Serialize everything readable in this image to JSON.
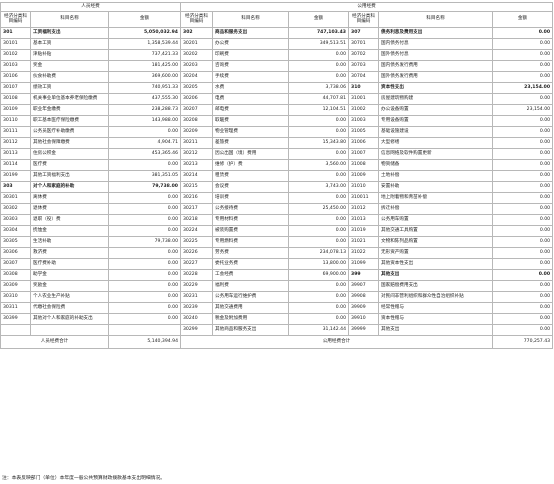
{
  "headers": {
    "personnel_group": "人员经费",
    "public_group": "公用经费",
    "code_col": "经济分类科目编码",
    "name_col": "科目名称",
    "amount_col": "金额"
  },
  "rows": [
    {
      "c1": "301",
      "n1": "工资福利支出",
      "a1": "5,050,032.94",
      "c2": "302",
      "n2": "商品和服务支出",
      "a2": "747,103.43",
      "c3": "307",
      "n3": "债务利息及费用支出",
      "a3": "0.00",
      "sub1": true,
      "sub2": true,
      "sub3": true
    },
    {
      "c1": "30101",
      "n1": "基本工资",
      "a1": "1,358,539.44",
      "c2": "30201",
      "n2": "办公费",
      "a2": "349,513.51",
      "c3": "30701",
      "n3": "国内债务付息",
      "a3": "0.00"
    },
    {
      "c1": "30102",
      "n1": "津贴补贴",
      "a1": "737,421.33",
      "c2": "30202",
      "n2": "印刷费",
      "a2": "0.00",
      "c3": "30702",
      "n3": "国外债务付息",
      "a3": "0.00"
    },
    {
      "c1": "30103",
      "n1": "奖金",
      "a1": "181,425.00",
      "c2": "30203",
      "n2": "咨询费",
      "a2": "0.00",
      "c3": "30703",
      "n3": "国内债务发行费用",
      "a3": "0.00"
    },
    {
      "c1": "30106",
      "n1": "伙食补助费",
      "a1": "369,600.00",
      "c2": "30204",
      "n2": "手续费",
      "a2": "0.00",
      "c3": "30704",
      "n3": "国外债务发行费用",
      "a3": "0.00"
    },
    {
      "c1": "30107",
      "n1": "绩效工资",
      "a1": "740,951.33",
      "c2": "30205",
      "n2": "水费",
      "a2": "3,738.06",
      "c3": "310",
      "n3": "资本性支出",
      "a3": "23,154.00",
      "sub3": true
    },
    {
      "c1": "30108",
      "n1": "机关事业单位基本养老保险缴费",
      "a1": "437,555.30",
      "c2": "30206",
      "n2": "电费",
      "a2": "44,707.81",
      "c3": "31001",
      "n3": "房屋建筑物购建",
      "a3": "0.00"
    },
    {
      "c1": "30109",
      "n1": "职业年金缴费",
      "a1": "238,288.73",
      "c2": "30207",
      "n2": "邮电费",
      "a2": "12,104.51",
      "c3": "31002",
      "n3": "办公设备购置",
      "a3": "23,154.00"
    },
    {
      "c1": "30110",
      "n1": "职工基本医疗保险缴费",
      "a1": "143,988.00",
      "c2": "30208",
      "n2": "取暖费",
      "a2": "0.00",
      "c3": "31003",
      "n3": "专用设备购置",
      "a3": "0.00"
    },
    {
      "c1": "30111",
      "n1": "公务员医疗补助缴费",
      "a1": "0.00",
      "c2": "30209",
      "n2": "物业管理费",
      "a2": "0.00",
      "c3": "31005",
      "n3": "基础设施建设",
      "a3": "0.00"
    },
    {
      "c1": "30112",
      "n1": "其他社会保障缴费",
      "a1": "4,904.71",
      "c2": "30211",
      "n2": "差旅费",
      "a2": "15,343.80",
      "c3": "31006",
      "n3": "大型修缮",
      "a3": "0.00"
    },
    {
      "c1": "30113",
      "n1": "住房公积金",
      "a1": "453,365.46",
      "c2": "30212",
      "n2": "因公出国（境）费用",
      "a2": "0.00",
      "c3": "31007",
      "n3": "信息网络及软件购置更新",
      "a3": "0.00"
    },
    {
      "c1": "30114",
      "n1": "医疗费",
      "a1": "0.00",
      "c2": "30213",
      "n2": "维修（护）费",
      "a2": "3,560.00",
      "c3": "31008",
      "n3": "物资储备",
      "a3": "0.00"
    },
    {
      "c1": "30199",
      "n1": "其他工资福利支出",
      "a1": "381,351.05",
      "c2": "30214",
      "n2": "租赁费",
      "a2": "0.00",
      "c3": "31009",
      "n3": "土地补偿",
      "a3": "0.00"
    },
    {
      "c1": "303",
      "n1": "对个人和家庭的补助",
      "a1": "79,738.00",
      "c2": "30215",
      "n2": "会议费",
      "a2": "3,743.00",
      "c3": "31010",
      "n3": "安置补助",
      "a3": "0.00",
      "sub1": true
    },
    {
      "c1": "30301",
      "n1": "离休费",
      "a1": "0.00",
      "c2": "30216",
      "n2": "培训费",
      "a2": "0.00",
      "c3": "310011",
      "n3": "地上附着物和青苗补偿",
      "a3": "0.00"
    },
    {
      "c1": "30302",
      "n1": "退休费",
      "a1": "0.00",
      "c2": "30217",
      "n2": "公务接待费",
      "a2": "25,450.00",
      "c3": "31012",
      "n3": "拆迁补偿",
      "a3": "0.00"
    },
    {
      "c1": "30303",
      "n1": "退职（役）费",
      "a1": "0.00",
      "c2": "30218",
      "n2": "专用材料费",
      "a2": "0.00",
      "c3": "31013",
      "n3": "公务用车购置",
      "a3": "0.00"
    },
    {
      "c1": "30304",
      "n1": "抚恤金",
      "a1": "0.00",
      "c2": "30224",
      "n2": "被装购置费",
      "a2": "0.00",
      "c3": "31019",
      "n3": "其他交通工具购置",
      "a3": "0.00"
    },
    {
      "c1": "30305",
      "n1": "生活补助",
      "a1": "79,738.00",
      "c2": "30225",
      "n2": "专用燃料费",
      "a2": "0.00",
      "c3": "31021",
      "n3": "文物和陈列品购置",
      "a3": "0.00"
    },
    {
      "c1": "30306",
      "n1": "救济费",
      "a1": "0.00",
      "c2": "30226",
      "n2": "劳务费",
      "a2": "234,078.13",
      "c3": "31022",
      "n3": "无形资产购置",
      "a3": "0.00"
    },
    {
      "c1": "30307",
      "n1": "医疗费补助",
      "a1": "0.00",
      "c2": "30227",
      "n2": "委托业务费",
      "a2": "13,800.00",
      "c3": "31099",
      "n3": "其他资本性支出",
      "a3": "0.00"
    },
    {
      "c1": "30308",
      "n1": "助学金",
      "a1": "0.00",
      "c2": "30228",
      "n2": "工会经费",
      "a2": "69,900.00",
      "c3": "399",
      "n3": "其他支出",
      "a3": "0.00",
      "sub3": true
    },
    {
      "c1": "30309",
      "n1": "奖励金",
      "a1": "0.00",
      "c2": "30229",
      "n2": "福利费",
      "a2": "0.00",
      "c3": "39907",
      "n3": "国家赔偿费用支出",
      "a3": "0.00"
    },
    {
      "c1": "30310",
      "n1": "个人农业生产补贴",
      "a1": "0.00",
      "c2": "30231",
      "n2": "公务用车运行维护费",
      "a2": "0.00",
      "c3": "39908",
      "n3": "对民间非营利组织和群众性自治组织补贴",
      "a3": "0.00"
    },
    {
      "c1": "30311",
      "n1": "代缴社会保险费",
      "a1": "0.00",
      "c2": "30239",
      "n2": "其他交通费用",
      "a2": "0.00",
      "c3": "39909",
      "n3": "经常性赠与",
      "a3": "0.00"
    },
    {
      "c1": "30399",
      "n1": "其他对个人和家庭的补助支出",
      "a1": "0.00",
      "c2": "30240",
      "n2": "税金及附加费用",
      "a2": "0.00",
      "c3": "39910",
      "n3": "资本性赠与",
      "a3": "0.00"
    },
    {
      "c1": "",
      "n1": "",
      "a1": "",
      "c2": "30299",
      "n2": "其他商品和服务支出",
      "a2": "31,142.44",
      "c3": "39999",
      "n3": "其他支出",
      "a3": "0.00"
    }
  ],
  "totals": {
    "personnel_label": "人员经费合计",
    "personnel_amount": "5,140,394.94",
    "public_label": "公用经费合计",
    "public_amount": "770,257.43"
  },
  "note": "注：本表反映部门（单位）本年度一般公共预算财政拨款基本支出明细情况。"
}
